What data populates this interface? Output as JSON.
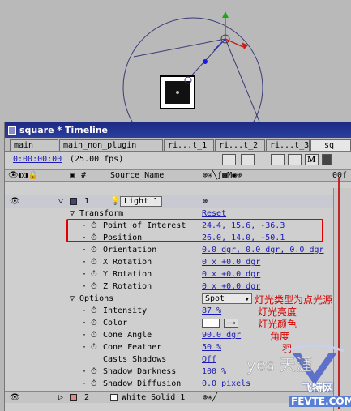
{
  "window": {
    "title": "square * Timeline"
  },
  "tabs": [
    "main",
    "main_non_plugin",
    "ri...t_1",
    "ri...t_2",
    "ri...t_3",
    "sq"
  ],
  "controls": {
    "timecode": "0:00:00:00",
    "fps": "(25.00 fps)",
    "m_label": "M"
  },
  "columns": {
    "num": "#",
    "source_name": "Source Name",
    "timeline_start": "00f"
  },
  "layers": [
    {
      "num": "1",
      "name": "Light 1",
      "color": "#4a4080"
    },
    {
      "num": "2",
      "name": "White Solid 1",
      "color": "#e08a8a"
    }
  ],
  "transform": {
    "label": "Transform",
    "reset": "Reset",
    "props": [
      {
        "name": "Point of Interest",
        "value": "24.4, 15.6, -36.3"
      },
      {
        "name": "Position",
        "value": "26.0, 14.0, -50.1"
      },
      {
        "name": "Orientation",
        "value": "0.0 dgr, 0.0 dgr, 0.0 dgr"
      },
      {
        "name": "X Rotation",
        "value": "0 x +0.0 dgr"
      },
      {
        "name": "Y Rotation",
        "value": "0 x +0.0 dgr"
      },
      {
        "name": "Z Rotation",
        "value": "0 x +0.0 dgr"
      }
    ]
  },
  "options": {
    "label": "Options",
    "light_type": "Spot",
    "props": [
      {
        "name": "Intensity",
        "value": "87 %"
      },
      {
        "name": "Color",
        "value": ""
      },
      {
        "name": "Cone Angle",
        "value": "90.0 dgr"
      },
      {
        "name": "Cone Feather",
        "value": "50 %"
      },
      {
        "name": "Casts Shadows",
        "value": "Off"
      },
      {
        "name": "Shadow Darkness",
        "value": "100 %"
      },
      {
        "name": "Shadow Diffusion",
        "value": "0.0 pixels"
      }
    ]
  },
  "annotations": [
    "灯光类型为点光源",
    "灯光亮度",
    "灯光颜色",
    "角度",
    "羽"
  ],
  "watermark": {
    "brand": "FEVTE.COM",
    "cn": "飞特网",
    "text": "yes 天涯"
  },
  "colors": {
    "accent": "#1a1ab8",
    "annotation": "#d60000",
    "title_bar": "#1c2a84"
  }
}
